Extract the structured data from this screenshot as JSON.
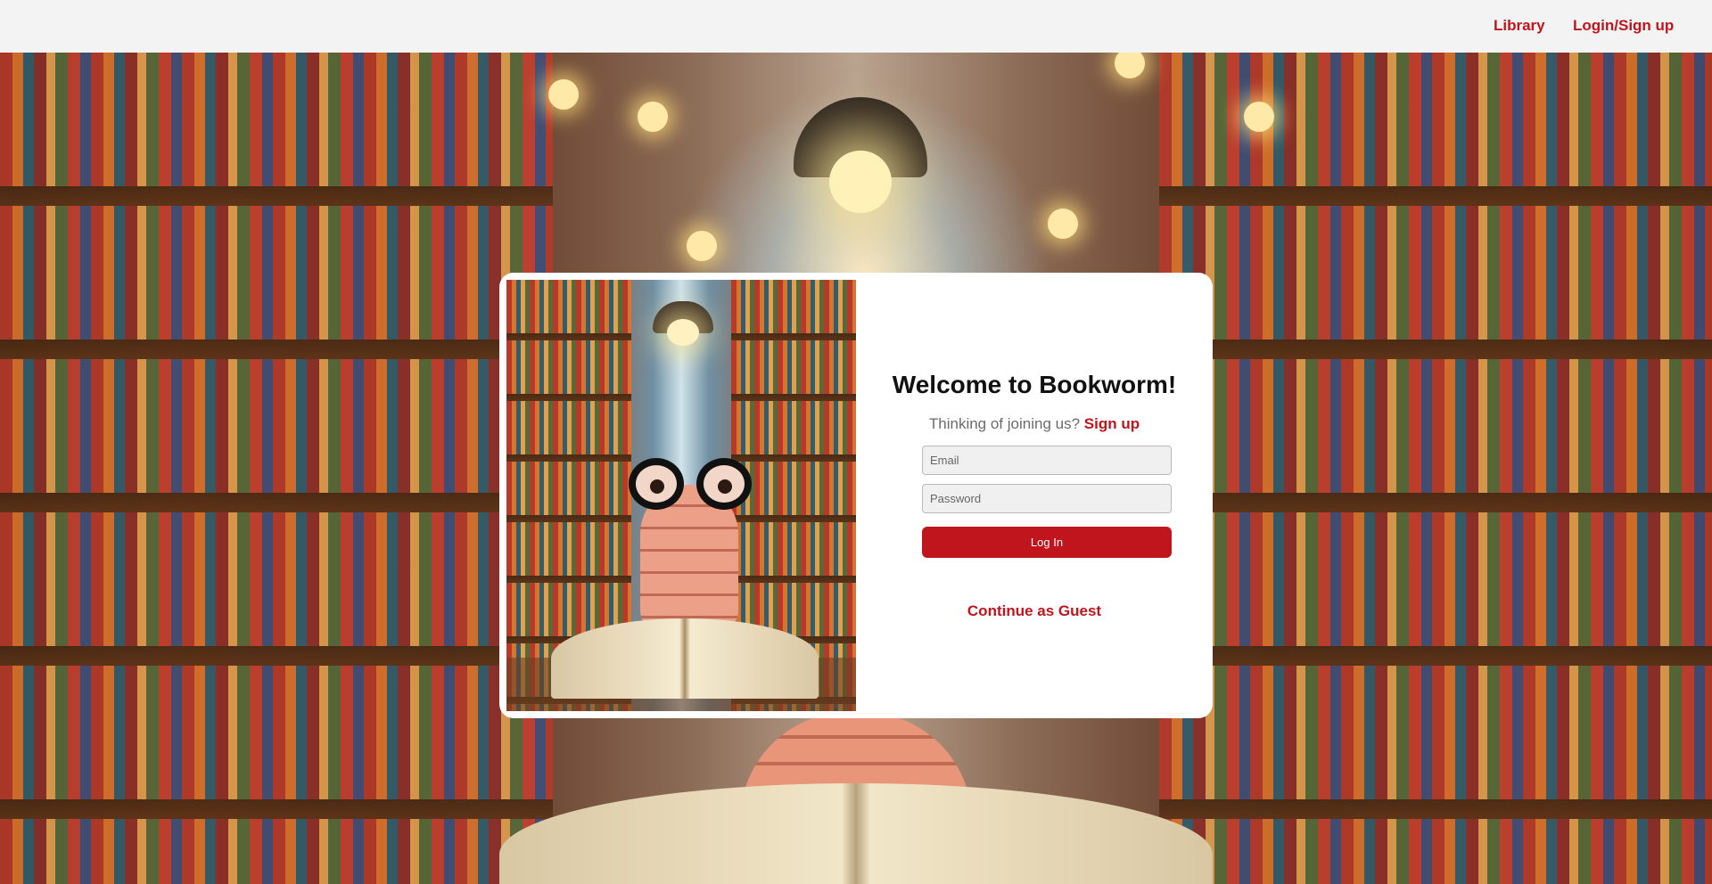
{
  "nav": {
    "library_label": "Library",
    "login_label": "Login/Sign up"
  },
  "login": {
    "title": "Welcome to Bookworm!",
    "join_prompt": "Thinking of joining us?",
    "signup_label": "Sign up",
    "email_placeholder": "Email",
    "password_placeholder": "Password",
    "login_button_label": "Log In",
    "guest_label": "Continue as Guest"
  },
  "colors": {
    "accent": "#c0151d",
    "navbar_bg": "#f3f3f3",
    "card_bg": "#ffffff"
  }
}
